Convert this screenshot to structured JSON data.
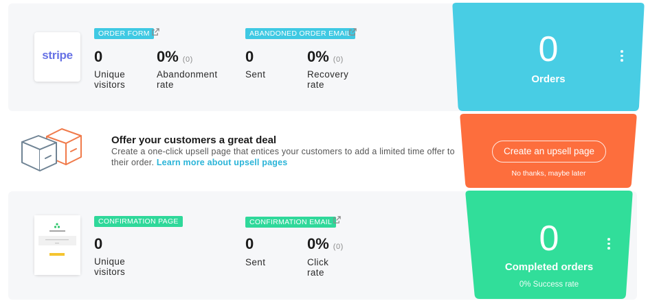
{
  "colors": {
    "orders_funnel": "#48cde4",
    "upsell_funnel": "#fd6e3d",
    "completed_funnel": "#31de9a",
    "tag_blue": "#3fc9e3",
    "tag_green": "#2fd89a",
    "link": "#2ab4d8"
  },
  "order_form": {
    "tag": "ORDER FORM",
    "logo_text": "stripe",
    "unique_visitors_value": "0",
    "unique_visitors_label_1": "Unique",
    "unique_visitors_label_2": "visitors",
    "abandonment_value": "0%",
    "abandonment_count": "(0)",
    "abandonment_label_1": "Abandonment",
    "abandonment_label_2": "rate"
  },
  "abandoned_email": {
    "tag": "ABANDONED ORDER EMAIL",
    "sent_value": "0",
    "sent_label": "Sent",
    "recovery_value": "0%",
    "recovery_count": "(0)",
    "recovery_label_1": "Recovery",
    "recovery_label_2": "rate"
  },
  "orders_funnel": {
    "value": "0",
    "label": "Orders",
    "menu_icon": "kebab-menu-icon"
  },
  "upsell": {
    "icon": "boxes-icon",
    "title": "Offer your customers a great deal",
    "description": "Create a one-click upsell page that entices your customers to add a limited time offer to their order.",
    "link_text": "Learn more about upsell pages",
    "button_label": "Create an upsell page",
    "dismiss_label": "No thanks, maybe later"
  },
  "confirmation_page": {
    "tag": "CONFIRMATION PAGE",
    "unique_visitors_value": "0",
    "unique_visitors_label_1": "Unique",
    "unique_visitors_label_2": "visitors"
  },
  "confirmation_email": {
    "tag": "CONFIRMATION EMAIL",
    "sent_value": "0",
    "sent_label": "Sent",
    "click_value": "0%",
    "click_count": "(0)",
    "click_label_1": "Click",
    "click_label_2": "rate"
  },
  "completed_funnel": {
    "value": "0",
    "label": "Completed orders",
    "success_rate": "0% Success rate",
    "menu_icon": "kebab-menu-icon"
  }
}
